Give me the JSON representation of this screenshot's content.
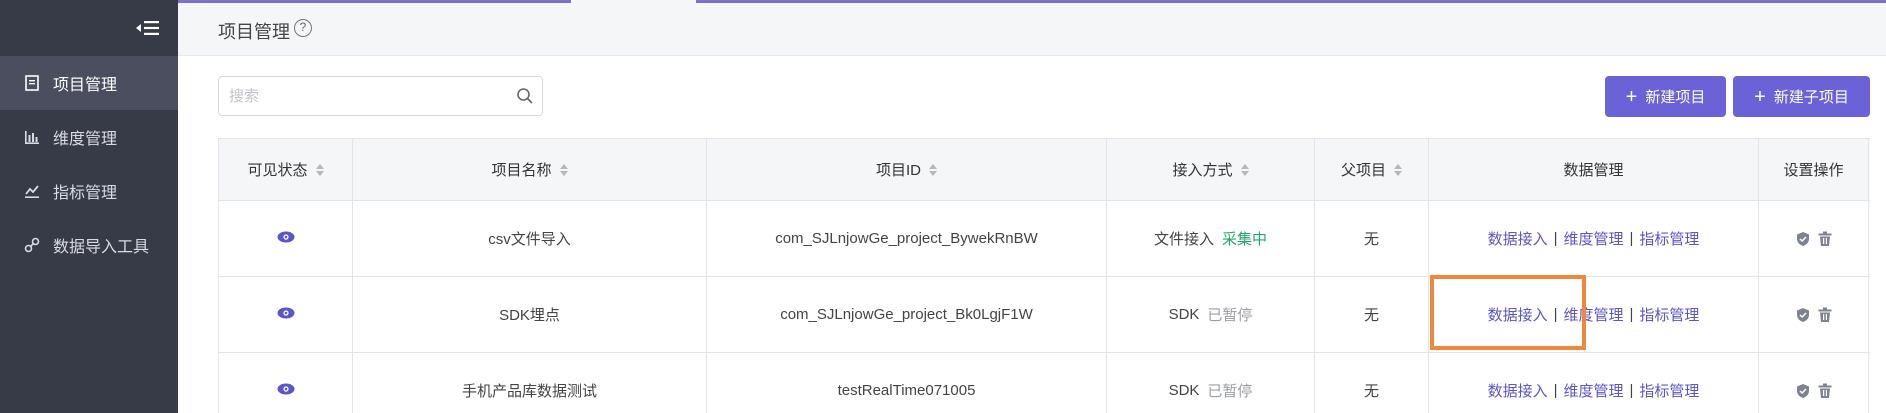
{
  "sidebar": {
    "items": [
      {
        "label": "项目管理",
        "icon": "document-icon",
        "active": true
      },
      {
        "label": "维度管理",
        "icon": "bar-chart-icon",
        "active": false
      },
      {
        "label": "指标管理",
        "icon": "line-chart-icon",
        "active": false
      },
      {
        "label": "数据导入工具",
        "icon": "link-icon",
        "active": false
      }
    ]
  },
  "header": {
    "title": "项目管理",
    "help": "?"
  },
  "search": {
    "placeholder": "搜索",
    "value": ""
  },
  "toolbar": {
    "new_project": "新建项目",
    "new_subproject": "新建子项目",
    "plus": "+"
  },
  "table": {
    "columns": [
      "可见状态",
      "项目名称",
      "项目ID",
      "接入方式",
      "父项目",
      "数据管理",
      "设置操作"
    ],
    "rows": [
      {
        "name": "csv文件导入",
        "id": "com_SJLnjowGe_project_BywekRnBW",
        "access": "文件接入",
        "status": "采集中",
        "parent": "无"
      },
      {
        "name": "SDK埋点",
        "id": "com_SJLnjowGe_project_Bk0LgjF1W",
        "access": "SDK",
        "status": "已暂停",
        "parent": "无"
      },
      {
        "name": "手机产品库数据测试",
        "id": "testRealTime071005",
        "access": "SDK",
        "status": "已暂停",
        "parent": "无"
      }
    ],
    "data_links": [
      "数据接入",
      "维度管理",
      "指标管理"
    ],
    "separator": "|"
  },
  "colors": {
    "accent": "#6b62d8",
    "sidebar": "#373a47",
    "status_active": "#22a86b",
    "highlight": "#f0883c"
  }
}
